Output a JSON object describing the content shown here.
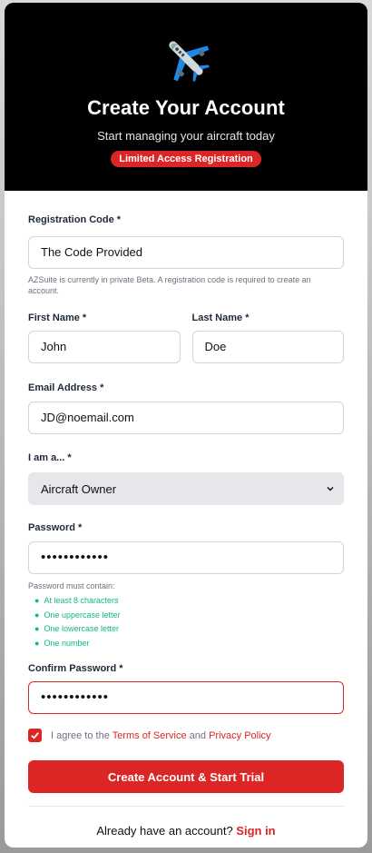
{
  "header": {
    "icon": "airplane-icon",
    "title": "Create Your Account",
    "subtitle": "Start managing your aircraft today",
    "badge": "Limited Access Registration"
  },
  "form": {
    "registration_code": {
      "label": "Registration Code *",
      "value": "The Code Provided",
      "help": "AZSuite is currently in private Beta. A registration code is required to create an account."
    },
    "first_name": {
      "label": "First Name *",
      "value": "John"
    },
    "last_name": {
      "label": "Last Name *",
      "value": "Doe"
    },
    "email": {
      "label": "Email Address *",
      "value": "JD@noemail.com"
    },
    "role": {
      "label": "I am a... *",
      "selected": "Aircraft Owner",
      "icon": "chevron-down-icon"
    },
    "password": {
      "label": "Password *",
      "masked": "••••••••••••",
      "requirements_title": "Password must contain:",
      "requirements": [
        "At least 8 characters",
        "One uppercase letter",
        "One lowercase letter",
        "One number"
      ]
    },
    "confirm_password": {
      "label": "Confirm Password *",
      "masked": "••••••••••••"
    },
    "agree": {
      "checked": true,
      "prefix": "I agree to the",
      "terms_link": "Terms of Service",
      "and": "and",
      "privacy_link": "Privacy Policy"
    },
    "submit_label": "Create Account & Start Trial",
    "signin_prompt": "Already have an account?",
    "signin_link": "Sign in"
  },
  "colors": {
    "accent": "#dc2626",
    "header_bg": "#000000",
    "success": "#10b981"
  }
}
